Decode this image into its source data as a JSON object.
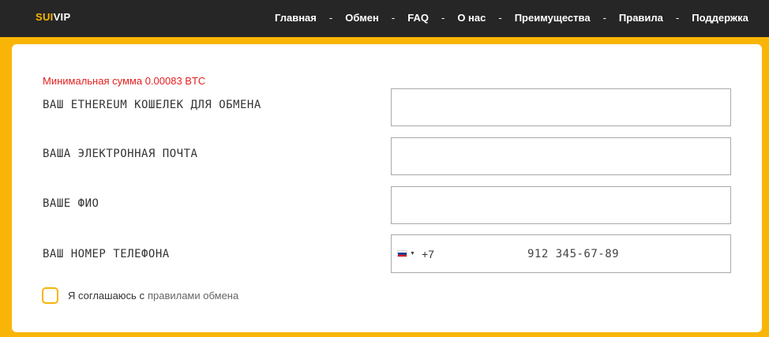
{
  "header": {
    "logo_part1": "SUI",
    "logo_part2": "VIP",
    "nav": [
      "Главная",
      "Обмен",
      "FAQ",
      "О нас",
      "Преимущества",
      "Правила",
      "Поддержка"
    ],
    "separator": "-"
  },
  "form": {
    "min_amount_text": "Минимальная сумма 0.00083 BTC",
    "fields": {
      "wallet_label": "ВАШ ETHEREUM КОШЕЛЕК ДЛЯ ОБМЕНА",
      "wallet_value": "",
      "email_label": "ВАША ЭЛЕКТРОННАЯ ПОЧТА",
      "email_value": "",
      "name_label": "ВАШЕ ФИО",
      "name_value": "",
      "phone_label": "ВАШ НОМЕР ТЕЛЕФОНА",
      "phone_country_code": "+7",
      "phone_placeholder": "912 345-67-89",
      "phone_country_flag": "russia-flag-icon"
    },
    "agree_text": "Я соглашаюсь с",
    "agree_link": "правилами обмена"
  },
  "colors": {
    "accent": "#f9b507",
    "topbar": "#262626",
    "error": "#e31e1e"
  }
}
